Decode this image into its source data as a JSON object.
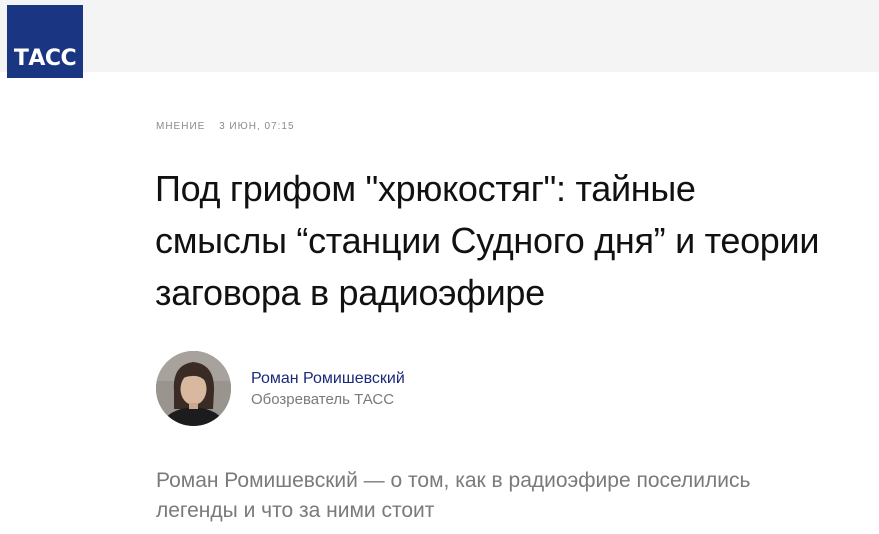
{
  "brand": {
    "logo_text": "ТАСС",
    "logo_color": "#1a3582"
  },
  "article": {
    "rubric": "Мнение",
    "date": "3 июн, 07:15",
    "headline": "Под грифом \"хрюкостяг\": тайные смыслы “станции Судного дня” и теории заговора в радиоэфире",
    "author": {
      "name": "Роман Ромишевский",
      "role": "Обозреватель ТАСС",
      "name_color": "#1a2a7a"
    },
    "lead": "Роман Ромишевский — о том, как в радиоэфире поселились легенды и что за ними стоит"
  }
}
